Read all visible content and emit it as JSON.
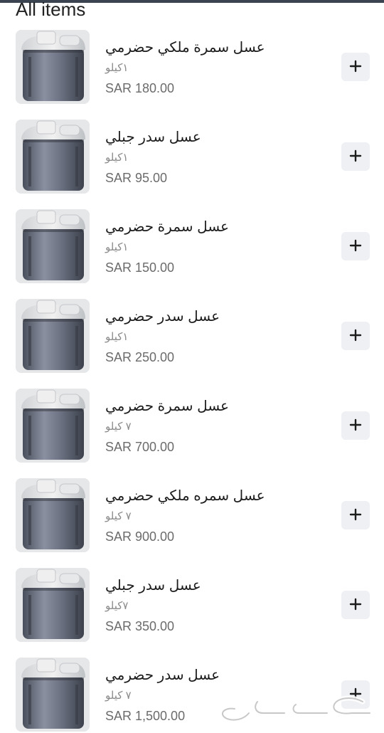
{
  "section": {
    "title": "All items"
  },
  "items": [
    {
      "name": "عسل سمرة ملكي حضرمي",
      "unit": "١كيلو",
      "price": "SAR 180.00"
    },
    {
      "name": "عسل سدر جبلي",
      "unit": "١كيلو",
      "price": "SAR 95.00"
    },
    {
      "name": "عسل سمرة حضرمي",
      "unit": "١كيلو",
      "price": "SAR 150.00"
    },
    {
      "name": "عسل سدر حضرمي",
      "unit": "١كيلو",
      "price": "SAR 250.00"
    },
    {
      "name": "عسل سمرة حضرمي",
      "unit": "٧ كيلو",
      "price": "SAR 700.00"
    },
    {
      "name": "عسل سمره ملكي حضرمي",
      "unit": "٧ كيلو",
      "price": "SAR 900.00"
    },
    {
      "name": "عسل سدر جبلي",
      "unit": "٧كيلو",
      "price": "SAR 350.00"
    },
    {
      "name": "عسل سدر حضرمي",
      "unit": "٧ كيلو",
      "price": "SAR 1,500.00"
    }
  ],
  "add_button_icon": "plus-icon",
  "watermark_text": "حراج",
  "colors": {
    "topbar": "#3a4450",
    "button_bg": "#eef0f3",
    "price_text": "#6b6b6b",
    "unit_text": "#8a8a8a"
  }
}
